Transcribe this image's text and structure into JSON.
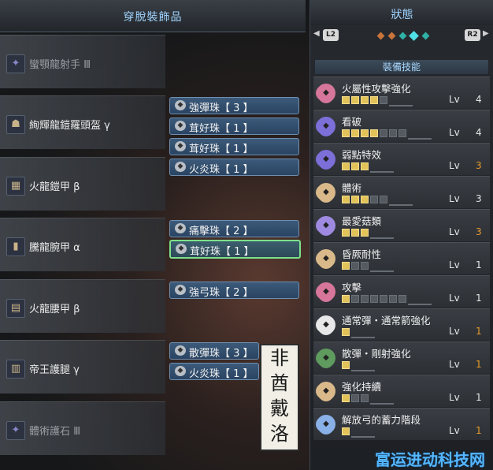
{
  "left_panel": {
    "title": "穿脫裝飾品",
    "slots": [
      {
        "name": "蠻顎龍射手 Ⅲ",
        "icon": "charm-icon"
      },
      {
        "name": "絢輝龍鎧羅頭盔 γ",
        "icon": "helmet-icon"
      },
      {
        "name": "火龍鎧甲 β",
        "icon": "chest-armor-icon"
      },
      {
        "name": "騰龍腕甲 α",
        "icon": "arm-armor-icon"
      },
      {
        "name": "火龍腰甲 β",
        "icon": "waist-armor-icon"
      },
      {
        "name": "帝王護腿 γ",
        "icon": "leg-armor-icon"
      },
      {
        "name": "體術護石 Ⅲ",
        "icon": "charm-icon"
      }
    ],
    "decorations": [
      {
        "label": "強彈珠【 3 】"
      },
      {
        "label": "茸好珠【 1 】"
      },
      {
        "label": "茸好珠【 1 】"
      },
      {
        "label": "火炎珠【 1 】"
      },
      {
        "label": "痛擊珠【 2 】"
      },
      {
        "label": "茸好珠【 1 】"
      },
      {
        "label": "強弓珠【 2 】"
      },
      {
        "label": "散彈珠【 3 】"
      },
      {
        "label": "火炎珠【 1 】"
      }
    ],
    "stamp_chars": [
      "非",
      "酋",
      "戴",
      "洛"
    ]
  },
  "right_panel": {
    "title": "狀態",
    "pager": {
      "left": "L2",
      "right": "R2"
    },
    "section": "裝備技能",
    "skills": [
      {
        "name": "火屬性攻擊強化",
        "level_label": "Lv",
        "level": "4",
        "filled": 4,
        "slots": 5,
        "max": false,
        "color": "#d5769a"
      },
      {
        "name": "看破",
        "level_label": "Lv",
        "level": "4",
        "filled": 4,
        "slots": 7,
        "max": false,
        "color": "#7d6fd8"
      },
      {
        "name": "弱點特效",
        "level_label": "Lv",
        "level": "3",
        "filled": 3,
        "slots": 3,
        "max": true,
        "color": "#7d6fd8"
      },
      {
        "name": "體術",
        "level_label": "Lv",
        "level": "3",
        "filled": 3,
        "slots": 5,
        "max": false,
        "color": "#d9b98a"
      },
      {
        "name": "最愛菇類",
        "level_label": "Lv",
        "level": "3",
        "filled": 3,
        "slots": 3,
        "max": true,
        "color": "#9e8ae0"
      },
      {
        "name": "昏厥耐性",
        "level_label": "Lv",
        "level": "1",
        "filled": 1,
        "slots": 3,
        "max": false,
        "color": "#d9b98a"
      },
      {
        "name": "攻擊",
        "level_label": "Lv",
        "level": "1",
        "filled": 1,
        "slots": 7,
        "max": false,
        "color": "#d5769a"
      },
      {
        "name": "通常彈・通常箭強化",
        "level_label": "Lv",
        "level": "1",
        "filled": 1,
        "slots": 1,
        "max": true,
        "color": "#e8e8e8"
      },
      {
        "name": "散彈・剛射強化",
        "level_label": "Lv",
        "level": "1",
        "filled": 1,
        "slots": 1,
        "max": true,
        "color": "#5f9a5f"
      },
      {
        "name": "強化持續",
        "level_label": "Lv",
        "level": "1",
        "filled": 1,
        "slots": 3,
        "max": false,
        "color": "#d9b98a"
      },
      {
        "name": "解放弓的蓄力階段",
        "level_label": "Lv",
        "level": "1",
        "filled": 1,
        "slots": 1,
        "max": true,
        "color": "#8ab0e8"
      }
    ]
  },
  "watermark": "富运进动科技网"
}
